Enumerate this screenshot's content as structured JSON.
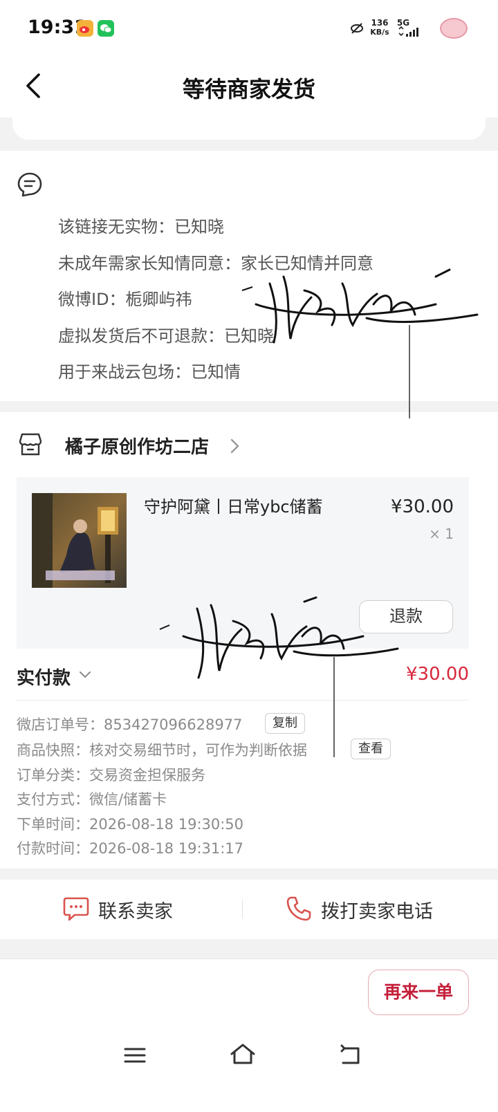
{
  "status_bar": {
    "time": "19:31",
    "net_speed": "136",
    "net_unit": "KB/s",
    "network": "5G",
    "icons": [
      "weibo-icon",
      "wechat-icon",
      "no-sim-icon",
      "signal-icon",
      "avatar-icon"
    ]
  },
  "header": {
    "title": "等待商家发货"
  },
  "notes": {
    "lines": [
      "该链接无实物：已知晓",
      "未成年需家长知情同意：家长已知情并同意",
      "微博ID：栀卿屿祎",
      "虚拟发货后不可退款：已知晓",
      "用于来战云包场：已知情"
    ]
  },
  "shop": {
    "name": "橘子原创作坊二店"
  },
  "product": {
    "title": "守护阿黛丨日常ybc储蓄",
    "price": "¥30.00",
    "quantity": "× 1",
    "refund_label": "退款"
  },
  "payment": {
    "paid_label": "实付款",
    "paid_amount": "¥30.00"
  },
  "order_info": {
    "order_no": "微店订单号：853427096628977",
    "copy_label": "复制",
    "snapshot": "商品快照：核对交易细节时，可作为判断依据",
    "view_label": "查看",
    "category": "订单分类：交易资金担保服务",
    "pay_method": "支付方式：微信/储蓄卡",
    "order_time": "下单时间：2026-08-18 19:30:50",
    "pay_time": "付款时间：2026-08-18 19:31:17"
  },
  "contact": {
    "chat_label": "联系卖家",
    "call_label": "拨打卖家电话"
  },
  "actions": {
    "reorder_label": "再来一单"
  },
  "colors": {
    "accent": "#d8263b",
    "icon_red": "#d9534f",
    "background": "#f2f2f2"
  }
}
